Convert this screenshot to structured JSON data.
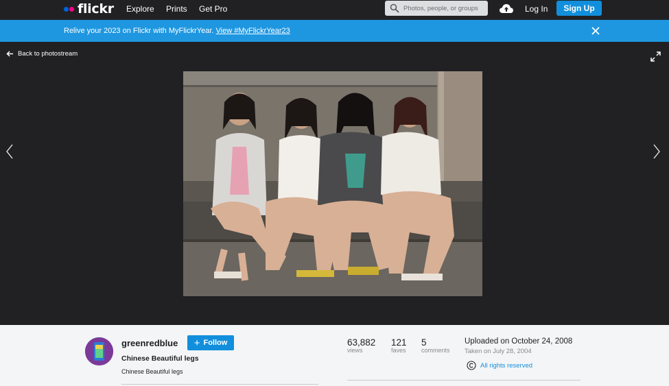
{
  "nav": {
    "logo": "flickr",
    "links": [
      "Explore",
      "Prints",
      "Get Pro"
    ],
    "search_placeholder": "Photos, people, or groups",
    "login": "Log In",
    "signup": "Sign Up"
  },
  "banner": {
    "text": "Relive your 2023 on Flickr with MyFlickrYear. ",
    "link": "View #MyFlickrYear23"
  },
  "viewer": {
    "back_label": "Back to photostream"
  },
  "photo_info": {
    "owner": "greenredblue",
    "follow_label": "Follow",
    "title": "Chinese Beautiful legs",
    "description": "Chinese Beautiful legs",
    "stats": [
      {
        "value": "63,882",
        "label": "views"
      },
      {
        "value": "121",
        "label": "faves"
      },
      {
        "value": "5",
        "label": "comments"
      }
    ],
    "uploaded": "Uploaded on October 24, 2008",
    "taken": "Taken on July 28, 2004",
    "rights": "All rights reserved"
  },
  "colors": {
    "nav_bg": "#212124",
    "banner_bg": "#1f97e0",
    "accent_blue": "#128fdc",
    "logo_blue": "#0063dc",
    "logo_pink": "#ff0084"
  }
}
